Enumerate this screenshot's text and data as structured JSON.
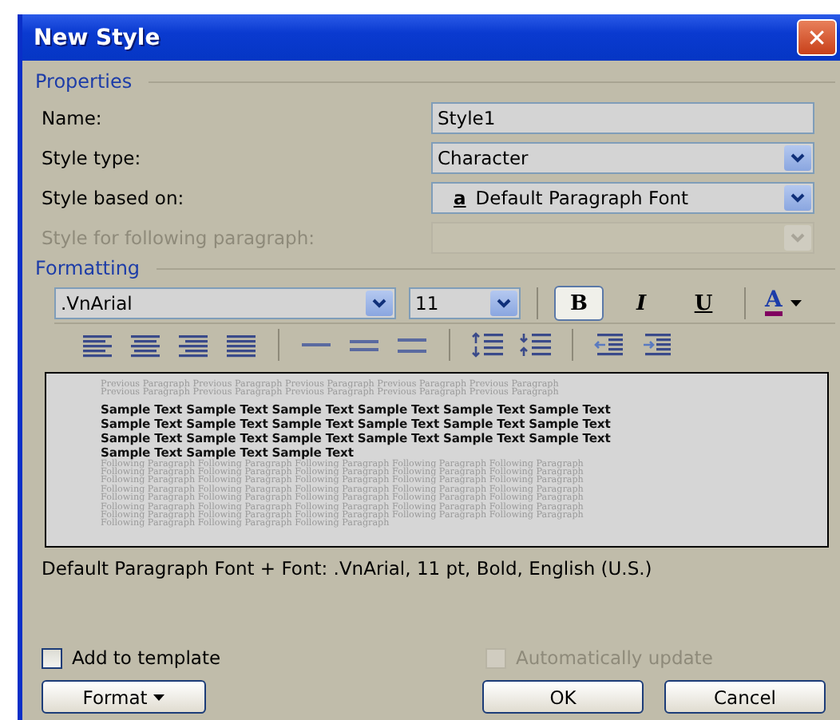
{
  "window": {
    "title": "New Style",
    "close_label": "✕"
  },
  "properties": {
    "heading": "Properties",
    "fields": [
      {
        "label": "Name:",
        "kind": "text",
        "value": "Style1",
        "disabled": false
      },
      {
        "label": "Style type:",
        "kind": "dropdown",
        "value": "Character",
        "disabled": false
      },
      {
        "label": "Style based on:",
        "kind": "dropdown",
        "value": "Default Paragraph Font",
        "prefix": "a",
        "disabled": false
      },
      {
        "label": "Style for following paragraph:",
        "kind": "dropdown",
        "disabled": true
      }
    ]
  },
  "formatting": {
    "heading": "Formatting",
    "font": ".VnArial",
    "size": "11",
    "style_buttons": [
      {
        "label": "B",
        "kind": "bold",
        "selected": true
      },
      {
        "label": "I",
        "kind": "italic",
        "selected": false
      },
      {
        "label": "U",
        "kind": "underline",
        "selected": false
      }
    ],
    "font_color": {
      "label": "A",
      "color": "#800060"
    }
  },
  "preview": {
    "previous_lines": [
      "Previous Paragraph Previous Paragraph Previous Paragraph Previous Paragraph Previous Paragraph",
      "Previous Paragraph Previous Paragraph Previous Paragraph Previous Paragraph Previous Paragraph"
    ],
    "sample_lines": [
      "Sample Text Sample Text Sample Text Sample Text Sample Text Sample Text",
      "Sample Text Sample Text Sample Text Sample Text Sample Text Sample Text",
      "Sample Text Sample Text Sample Text Sample Text Sample Text Sample Text",
      "Sample Text Sample Text Sample Text"
    ],
    "following_lines": [
      "Following Paragraph Following Paragraph Following Paragraph Following Paragraph Following Paragraph",
      "Following Paragraph Following Paragraph Following Paragraph Following Paragraph Following Paragraph",
      "Following Paragraph Following Paragraph Following Paragraph Following Paragraph Following Paragraph",
      "Following Paragraph Following Paragraph Following Paragraph Following Paragraph Following Paragraph",
      "Following Paragraph Following Paragraph Following Paragraph Following Paragraph Following Paragraph",
      "Following Paragraph Following Paragraph Following Paragraph Following Paragraph Following Paragraph",
      "Following Paragraph Following Paragraph Following Paragraph Following Paragraph Following Paragraph",
      "Following Paragraph Following Paragraph Following Paragraph"
    ]
  },
  "description": "Default Paragraph Font + Font: .VnArial, 11 pt, Bold, English (U.S.)",
  "options": [
    {
      "label": "Add to template",
      "checked": false,
      "disabled": false
    },
    {
      "label": "Automatically update",
      "checked": false,
      "disabled": true
    }
  ],
  "buttons": [
    {
      "label": "Format",
      "kind": "menu"
    },
    {
      "label": "OK",
      "kind": "plain"
    },
    {
      "label": "Cancel",
      "kind": "plain"
    }
  ]
}
